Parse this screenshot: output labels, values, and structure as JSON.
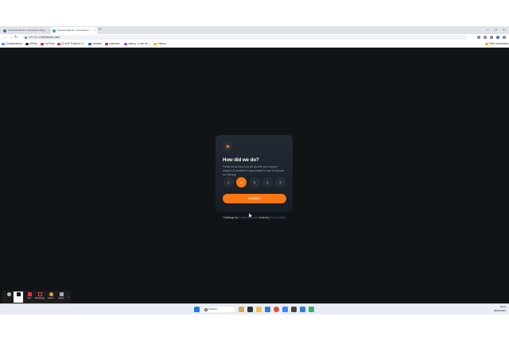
{
  "browser": {
    "tabs": [
      {
        "label": "Frontend Mentor | Interactive rating",
        "active": false
      },
      {
        "label": "Frontend Mentor | Interactive r...",
        "active": true
      }
    ],
    "new_tab": "+",
    "url": "127.0.0.1:5500/index.html",
    "bookmarks": [
      {
        "label": "Codeacademy",
        "color": "#4a90e2"
      },
      {
        "label": "GitHub",
        "color": "#222222"
      },
      {
        "label": "YouTube",
        "color": "#e62117"
      },
      {
        "label": "(2) w3F Product | G...",
        "color": "#d93025"
      },
      {
        "label": "LinkedIn",
        "color": "#0a66c2"
      },
      {
        "label": "codewars",
        "color": "#b1361e"
      },
      {
        "label": "udemy - It can be...",
        "color": "#a435f0"
      },
      {
        "label": "Folders",
        "color": "#f4b400"
      }
    ],
    "other_bookmarks": "Other bookmarks"
  },
  "card": {
    "star_icon": "★",
    "title": "How did we do?",
    "description": "Please let us know how we did with your support request. All feedback is appreciated to help us improve our offering!",
    "ratings": [
      "1",
      "2",
      "3",
      "4",
      "5"
    ],
    "selected_rating": "2",
    "submit_label": "SUBMIT"
  },
  "attribution": {
    "prefix": "Challenge by",
    "challenge_link": "Frontend Mentor",
    "middle": ". Coded by",
    "author_link": "Guivi Pinheiro"
  },
  "recorder": {
    "items": [
      "",
      "",
      "Pen",
      "Rectangle",
      "Eraser",
      "Erase"
    ]
  },
  "taskbar": {
    "search_label": "Search",
    "time": "10:42",
    "date": "08/04/2023"
  },
  "colors": {
    "accent": "#fc7614",
    "background": "#111416",
    "card": "#1f262e",
    "link": "#4a69c7"
  }
}
